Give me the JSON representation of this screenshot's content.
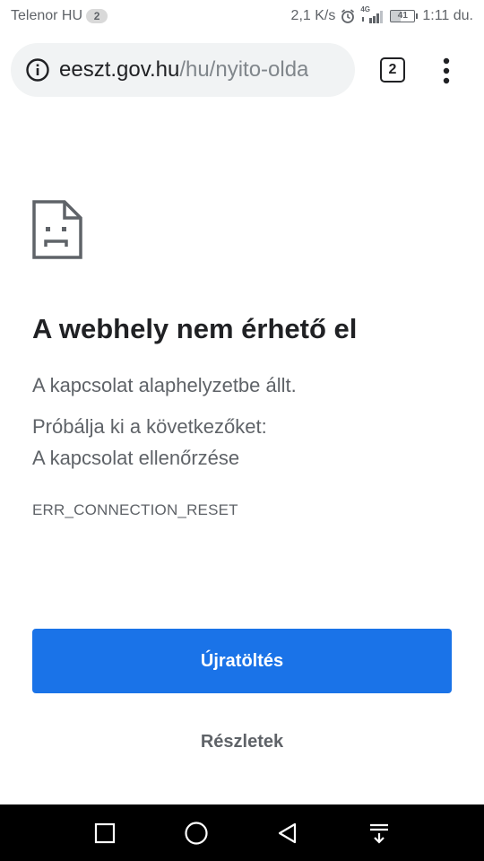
{
  "status_bar": {
    "carrier": "Telenor HU",
    "sim_badge": "2",
    "network_speed": "2,1 K/s",
    "network_type": "4G",
    "battery_level": "41",
    "battery_fraction": 0.41,
    "time": "1:11 du."
  },
  "toolbar": {
    "url_host": "eeszt.gov.hu",
    "url_path": "/hu/nyito-olda",
    "tab_count": "2"
  },
  "error_page": {
    "title": "A webhely nem érhető el",
    "message": "A kapcsolat alaphelyzetbe állt.",
    "suggestions_heading": "Próbálja ki a következőket:",
    "suggestions": [
      "A kapcsolat ellenőrzése"
    ],
    "error_code": "ERR_CONNECTION_RESET",
    "reload_label": "Újratöltés",
    "details_label": "Részletek"
  },
  "colors": {
    "accent": "#1a73e8",
    "text_primary": "#202124",
    "text_secondary": "#5f6368",
    "omnibox_bg": "#f1f3f4",
    "nav_bar": "#000000"
  },
  "icons": {
    "status": [
      "alarm-icon",
      "signal-icon",
      "battery-icon"
    ],
    "toolbar": [
      "info-icon",
      "tab-switcher-icon",
      "more-menu-icon"
    ],
    "page": [
      "sad-document-icon"
    ],
    "navigation": [
      "recent-apps-icon",
      "home-icon",
      "back-icon",
      "notification-pull-icon"
    ]
  }
}
